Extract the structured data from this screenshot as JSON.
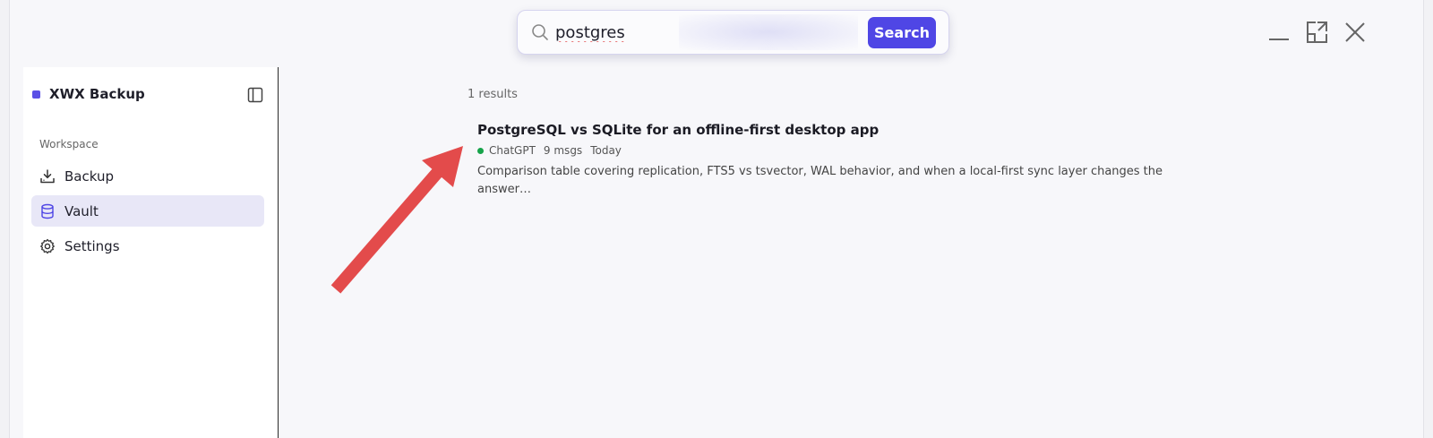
{
  "app": {
    "brand_name": "XWX Backup",
    "accent_color": "#4f46e5",
    "brand_dot_color": "#5b50e6"
  },
  "search": {
    "query": "postgres",
    "button_label": "Search",
    "icon": "search-icon"
  },
  "window_controls": [
    {
      "name": "minimize-icon"
    },
    {
      "name": "maximize-icon"
    },
    {
      "name": "close-icon"
    }
  ],
  "sidebar": {
    "section_label": "Workspace",
    "toggle_icon": "sidebar-toggle-icon",
    "items": [
      {
        "label": "Backup",
        "icon": "download-tray-icon",
        "active": false
      },
      {
        "label": "Vault",
        "icon": "database-icon",
        "active": true
      },
      {
        "label": "Settings",
        "icon": "gear-icon",
        "active": false
      }
    ]
  },
  "results": {
    "count_text": "1 results",
    "items": [
      {
        "title": "PostgreSQL vs SQLite for an offline-first desktop app",
        "source": "ChatGPT",
        "source_color": "#16a34a",
        "messages": "9 msgs",
        "date": "Today",
        "snippet": "Comparison table covering replication, FTS5 vs tsvector, WAL behavior, and when a local-first sync layer changes the answer…"
      }
    ]
  },
  "annotation": {
    "arrow_color": "#e34b4b"
  }
}
